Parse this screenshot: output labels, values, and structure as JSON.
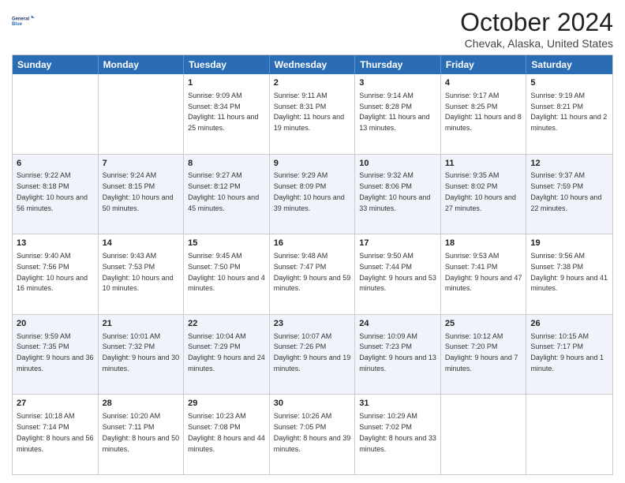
{
  "logo": {
    "line1": "General",
    "line2": "Blue"
  },
  "title": "October 2024",
  "subtitle": "Chevak, Alaska, United States",
  "weekdays": [
    "Sunday",
    "Monday",
    "Tuesday",
    "Wednesday",
    "Thursday",
    "Friday",
    "Saturday"
  ],
  "weeks": [
    [
      {
        "day": "",
        "detail": ""
      },
      {
        "day": "",
        "detail": ""
      },
      {
        "day": "1",
        "detail": "Sunrise: 9:09 AM\nSunset: 8:34 PM\nDaylight: 11 hours and 25 minutes."
      },
      {
        "day": "2",
        "detail": "Sunrise: 9:11 AM\nSunset: 8:31 PM\nDaylight: 11 hours and 19 minutes."
      },
      {
        "day": "3",
        "detail": "Sunrise: 9:14 AM\nSunset: 8:28 PM\nDaylight: 11 hours and 13 minutes."
      },
      {
        "day": "4",
        "detail": "Sunrise: 9:17 AM\nSunset: 8:25 PM\nDaylight: 11 hours and 8 minutes."
      },
      {
        "day": "5",
        "detail": "Sunrise: 9:19 AM\nSunset: 8:21 PM\nDaylight: 11 hours and 2 minutes."
      }
    ],
    [
      {
        "day": "6",
        "detail": "Sunrise: 9:22 AM\nSunset: 8:18 PM\nDaylight: 10 hours and 56 minutes."
      },
      {
        "day": "7",
        "detail": "Sunrise: 9:24 AM\nSunset: 8:15 PM\nDaylight: 10 hours and 50 minutes."
      },
      {
        "day": "8",
        "detail": "Sunrise: 9:27 AM\nSunset: 8:12 PM\nDaylight: 10 hours and 45 minutes."
      },
      {
        "day": "9",
        "detail": "Sunrise: 9:29 AM\nSunset: 8:09 PM\nDaylight: 10 hours and 39 minutes."
      },
      {
        "day": "10",
        "detail": "Sunrise: 9:32 AM\nSunset: 8:06 PM\nDaylight: 10 hours and 33 minutes."
      },
      {
        "day": "11",
        "detail": "Sunrise: 9:35 AM\nSunset: 8:02 PM\nDaylight: 10 hours and 27 minutes."
      },
      {
        "day": "12",
        "detail": "Sunrise: 9:37 AM\nSunset: 7:59 PM\nDaylight: 10 hours and 22 minutes."
      }
    ],
    [
      {
        "day": "13",
        "detail": "Sunrise: 9:40 AM\nSunset: 7:56 PM\nDaylight: 10 hours and 16 minutes."
      },
      {
        "day": "14",
        "detail": "Sunrise: 9:43 AM\nSunset: 7:53 PM\nDaylight: 10 hours and 10 minutes."
      },
      {
        "day": "15",
        "detail": "Sunrise: 9:45 AM\nSunset: 7:50 PM\nDaylight: 10 hours and 4 minutes."
      },
      {
        "day": "16",
        "detail": "Sunrise: 9:48 AM\nSunset: 7:47 PM\nDaylight: 9 hours and 59 minutes."
      },
      {
        "day": "17",
        "detail": "Sunrise: 9:50 AM\nSunset: 7:44 PM\nDaylight: 9 hours and 53 minutes."
      },
      {
        "day": "18",
        "detail": "Sunrise: 9:53 AM\nSunset: 7:41 PM\nDaylight: 9 hours and 47 minutes."
      },
      {
        "day": "19",
        "detail": "Sunrise: 9:56 AM\nSunset: 7:38 PM\nDaylight: 9 hours and 41 minutes."
      }
    ],
    [
      {
        "day": "20",
        "detail": "Sunrise: 9:59 AM\nSunset: 7:35 PM\nDaylight: 9 hours and 36 minutes."
      },
      {
        "day": "21",
        "detail": "Sunrise: 10:01 AM\nSunset: 7:32 PM\nDaylight: 9 hours and 30 minutes."
      },
      {
        "day": "22",
        "detail": "Sunrise: 10:04 AM\nSunset: 7:29 PM\nDaylight: 9 hours and 24 minutes."
      },
      {
        "day": "23",
        "detail": "Sunrise: 10:07 AM\nSunset: 7:26 PM\nDaylight: 9 hours and 19 minutes."
      },
      {
        "day": "24",
        "detail": "Sunrise: 10:09 AM\nSunset: 7:23 PM\nDaylight: 9 hours and 13 minutes."
      },
      {
        "day": "25",
        "detail": "Sunrise: 10:12 AM\nSunset: 7:20 PM\nDaylight: 9 hours and 7 minutes."
      },
      {
        "day": "26",
        "detail": "Sunrise: 10:15 AM\nSunset: 7:17 PM\nDaylight: 9 hours and 1 minute."
      }
    ],
    [
      {
        "day": "27",
        "detail": "Sunrise: 10:18 AM\nSunset: 7:14 PM\nDaylight: 8 hours and 56 minutes."
      },
      {
        "day": "28",
        "detail": "Sunrise: 10:20 AM\nSunset: 7:11 PM\nDaylight: 8 hours and 50 minutes."
      },
      {
        "day": "29",
        "detail": "Sunrise: 10:23 AM\nSunset: 7:08 PM\nDaylight: 8 hours and 44 minutes."
      },
      {
        "day": "30",
        "detail": "Sunrise: 10:26 AM\nSunset: 7:05 PM\nDaylight: 8 hours and 39 minutes."
      },
      {
        "day": "31",
        "detail": "Sunrise: 10:29 AM\nSunset: 7:02 PM\nDaylight: 8 hours and 33 minutes."
      },
      {
        "day": "",
        "detail": ""
      },
      {
        "day": "",
        "detail": ""
      }
    ]
  ]
}
